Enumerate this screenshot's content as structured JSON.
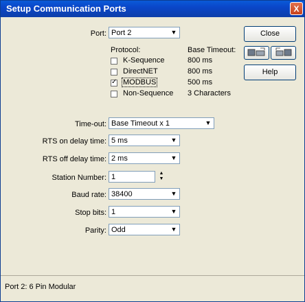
{
  "window": {
    "title": "Setup Communication Ports",
    "close_glyph": "X"
  },
  "port": {
    "label": "Port:",
    "value": "Port 2"
  },
  "buttons": {
    "close": "Close",
    "help": "Help"
  },
  "protocol": {
    "header": "Protocol:",
    "timeout_header": "Base Timeout:",
    "items": [
      {
        "name": "K-Sequence",
        "timeout": "800 ms",
        "checked": false
      },
      {
        "name": "DirectNET",
        "timeout": "800 ms",
        "checked": false
      },
      {
        "name": "MODBUS",
        "timeout": "500 ms",
        "checked": true
      },
      {
        "name": "Non-Sequence",
        "timeout": "3 Characters",
        "checked": false
      }
    ]
  },
  "timeout": {
    "label": "Time-out:",
    "value": "Base Timeout x 1"
  },
  "rts_on": {
    "label": "RTS on delay time:",
    "value": "5 ms"
  },
  "rts_off": {
    "label": "RTS off delay time:",
    "value": "2 ms"
  },
  "station": {
    "label": "Station Number:",
    "value": "1"
  },
  "baud": {
    "label": "Baud rate:",
    "value": "38400"
  },
  "stop": {
    "label": "Stop bits:",
    "value": "1"
  },
  "parity": {
    "label": "Parity:",
    "value": "Odd"
  },
  "statusbar": {
    "text": "Port 2: 6 Pin Modular"
  },
  "icons": {
    "upload": "pc-to-plc-icon",
    "download": "plc-to-pc-icon"
  }
}
